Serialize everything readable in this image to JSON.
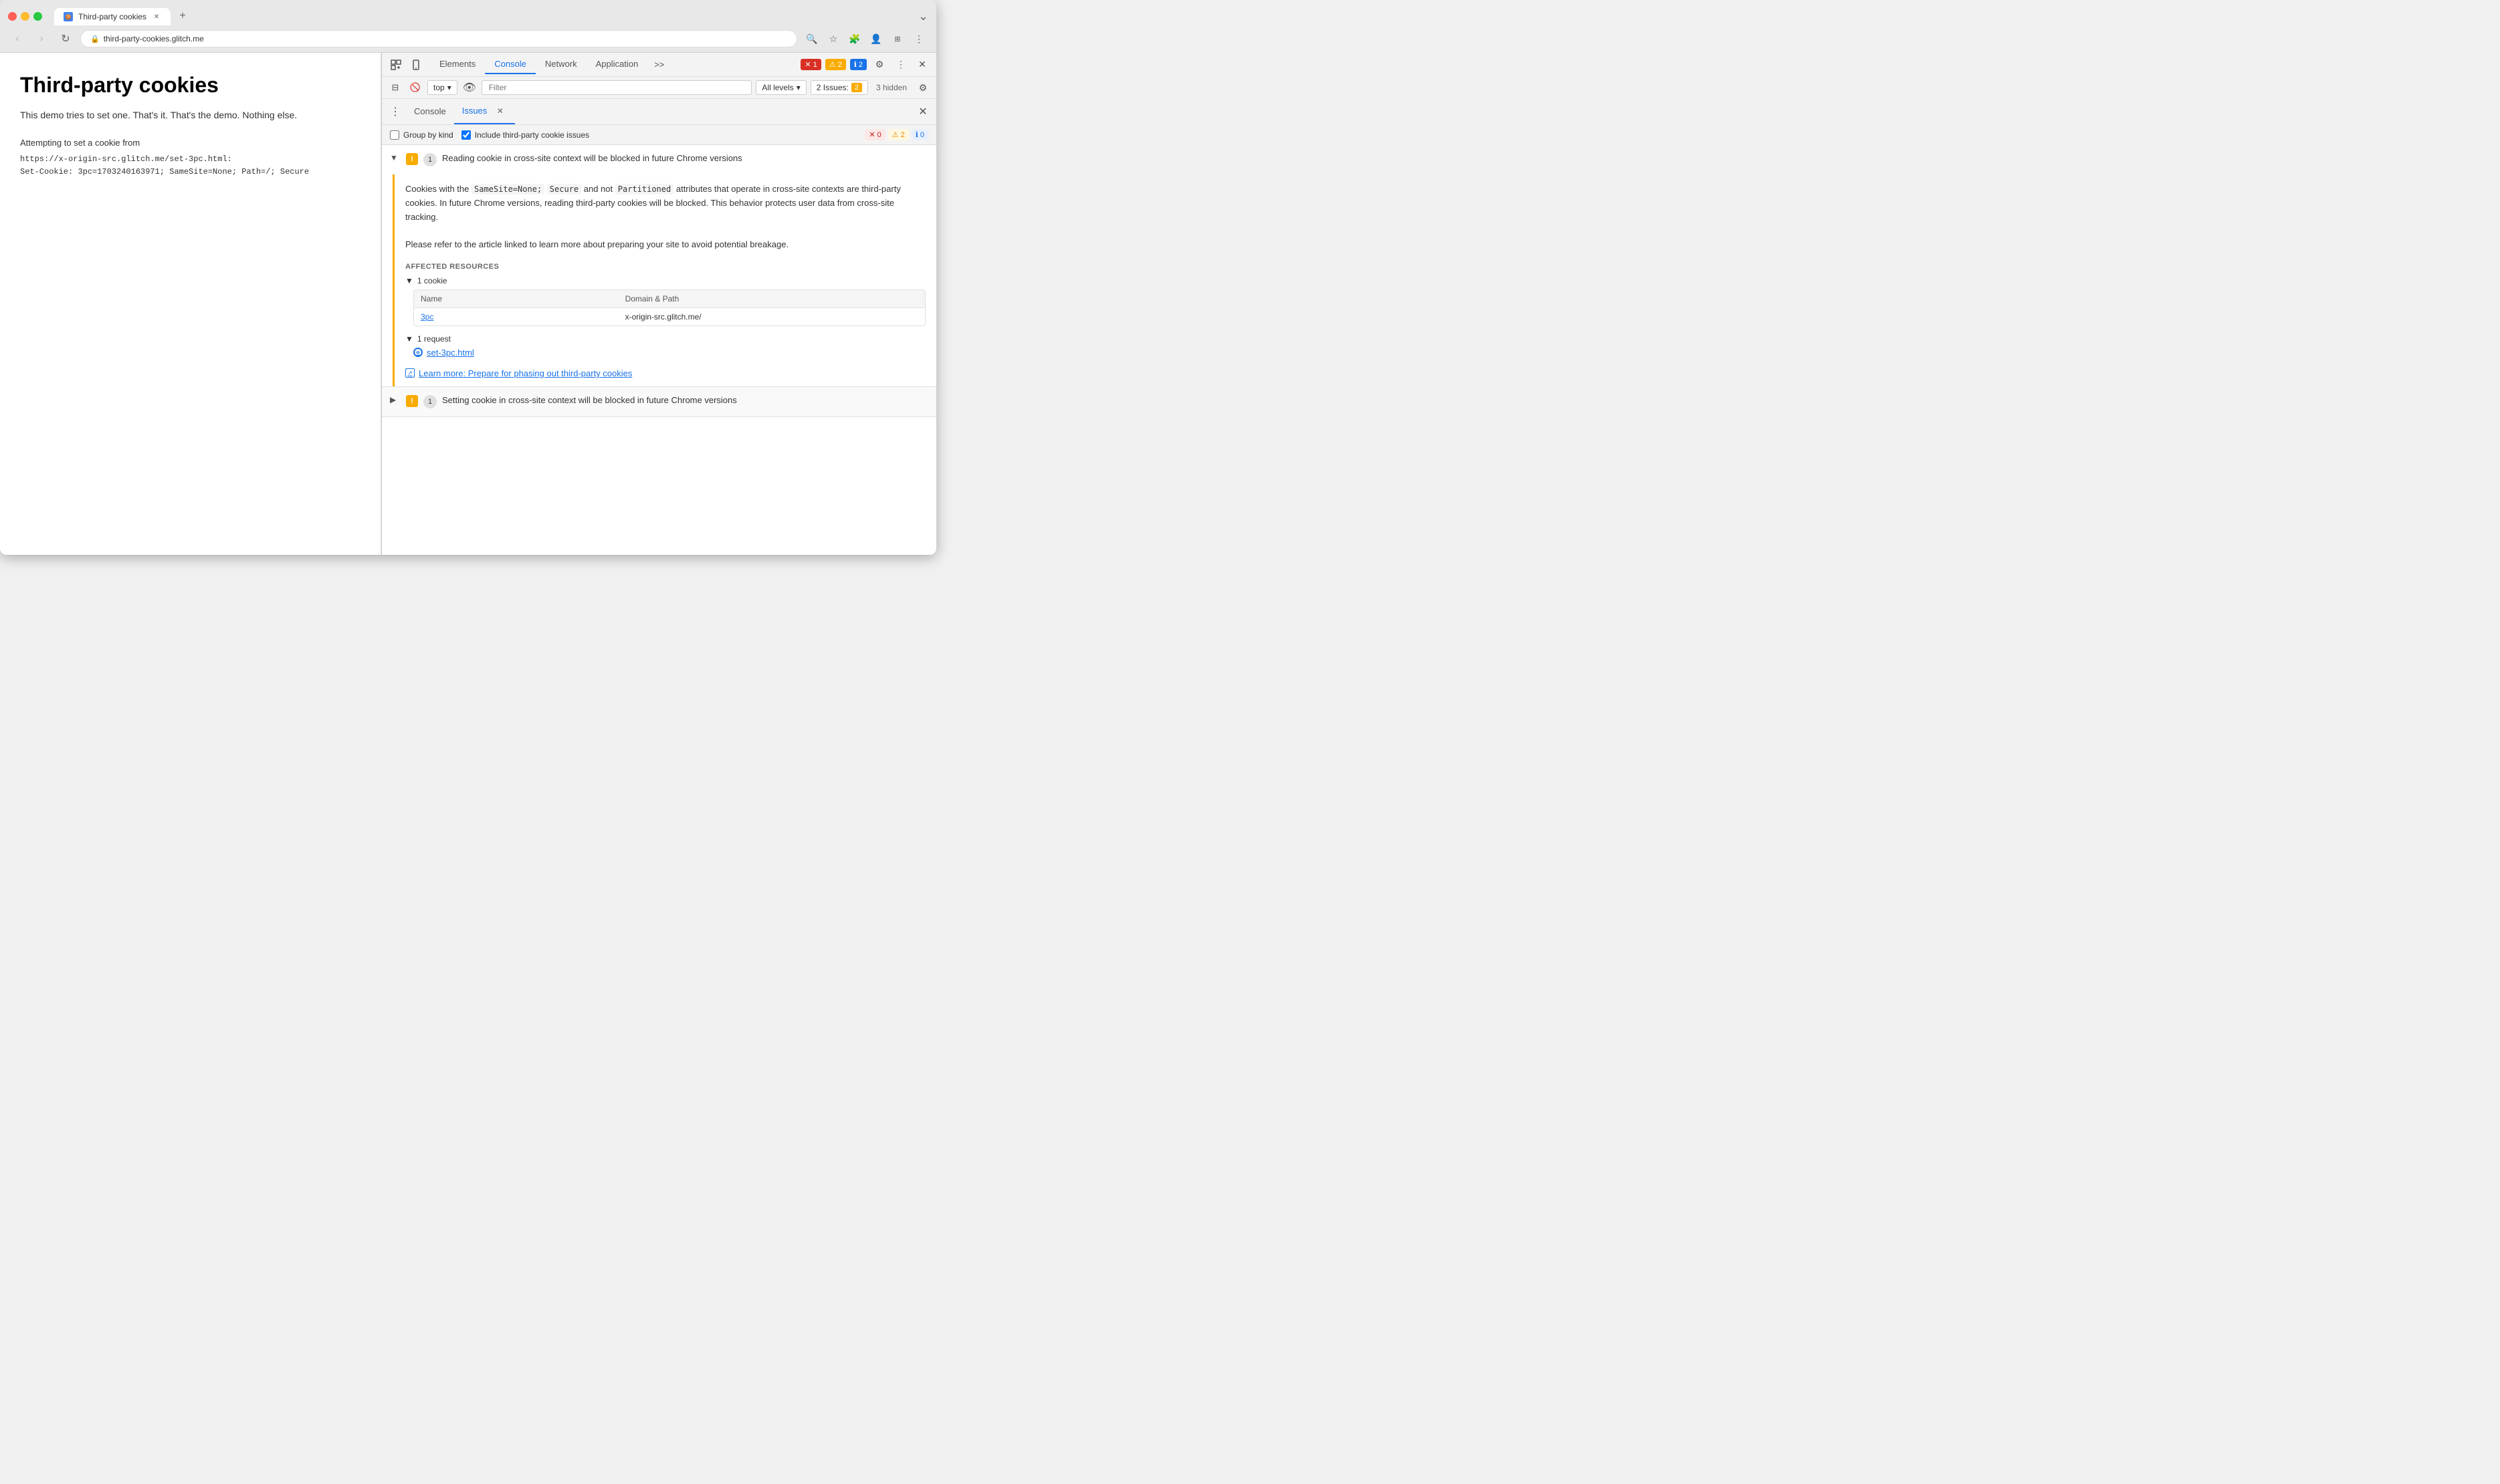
{
  "browser": {
    "tab_title": "Third-party cookies",
    "tab_favicon": "🍪",
    "address": "third-party-cookies.glitch.me",
    "address_lock": "🔒",
    "new_tab_label": "+",
    "minimize_btn": "−",
    "chevron_down": "⌄"
  },
  "page": {
    "title": "Third-party cookies",
    "description": "This demo tries to set one. That's it. That's the demo. Nothing else.",
    "attempt_label": "Attempting to set a cookie from",
    "cookie_url": "https://x-origin-src.glitch.me/set-3pc.html:",
    "cookie_value": "Set-Cookie: 3pc=1703240163971; SameSite=None; Path=/; Secure"
  },
  "devtools": {
    "tabs": [
      "Elements",
      "Console",
      "Network",
      "Application"
    ],
    "active_tab": "Console",
    "more_tabs": ">>",
    "error_count": "1",
    "warn_count": "2",
    "info_count": "2",
    "close_label": "✕",
    "settings_label": "⚙",
    "more_options": "⋮",
    "context_value": "top",
    "filter_placeholder": "Filter",
    "level_label": "All levels",
    "issues_label": "2 Issues:",
    "issues_warn": "2",
    "hidden_label": "3 hidden",
    "console_icon": "⊟",
    "clear_icon": "🚫",
    "eye_icon": "👁"
  },
  "issues_panel": {
    "menu_icon": "⋮",
    "tab_console": "Console",
    "tab_issues": "Issues",
    "close_panel": "✕",
    "group_by_label": "Group by kind",
    "include_third_party_label": "Include third-party cookie issues",
    "badge_error": "0",
    "badge_warn": "2",
    "badge_info": "0"
  },
  "issue1": {
    "expand_icon": "▼",
    "severity": "!",
    "count": "1",
    "title": "Reading cookie in cross-site context will be blocked in future Chrome versions",
    "description1": "Cookies with the",
    "code1": "SameSite=None;",
    "description2": "Secure",
    "code2": "Secure",
    "description3": "and not",
    "code3": "Partitioned",
    "description4": "attributes that operate in cross-site contexts are third-party cookies. In future Chrome versions, reading third-party cookies will be blocked. This behavior protects user data from cross-site tracking.",
    "description5": "Please refer to the article linked to learn more about preparing your site to avoid potential breakage.",
    "affected_label": "AFFECTED RESOURCES",
    "cookie_group_header": "▼ 1 cookie",
    "table_col1": "Name",
    "table_col2": "Domain & Path",
    "cookie_name": "3pc",
    "cookie_domain": "x-origin-src.glitch.me/",
    "request_group_header": "▼ 1 request",
    "request_icon": "⊕",
    "request_link": "set-3pc.html",
    "learn_more_icon": "↗",
    "learn_more_text": "Learn more: Prepare for phasing out third-party cookies"
  },
  "issue2": {
    "expand_icon": "▶",
    "severity": "!",
    "count": "1",
    "title": "Setting cookie in cross-site context will be blocked in future Chrome versions"
  }
}
